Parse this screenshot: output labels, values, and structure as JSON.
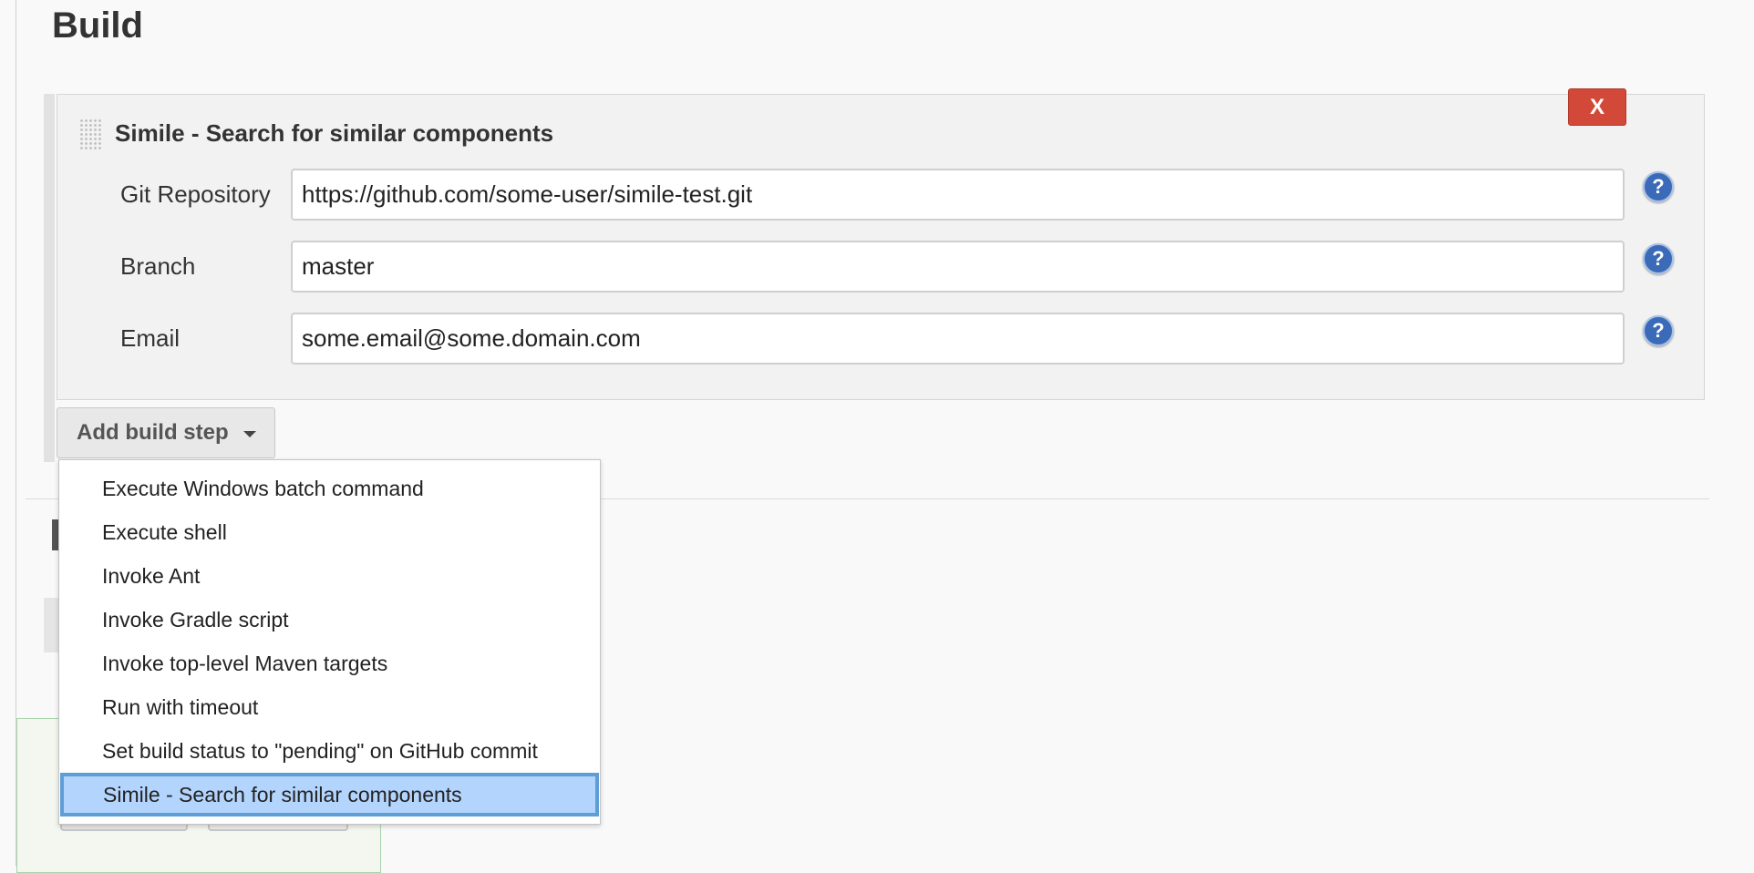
{
  "section": {
    "title": "Build"
  },
  "build_step": {
    "title": "Simile - Search for similar components",
    "delete_label": "X",
    "fields": [
      {
        "label": "Git Repository",
        "value": "https://github.com/some-user/simile-test.git"
      },
      {
        "label": "Branch",
        "value": "master"
      },
      {
        "label": "Email",
        "value": "some.email@some.domain.com"
      }
    ],
    "help_label": "?"
  },
  "add_build_step": {
    "label": "Add build step"
  },
  "dropdown": {
    "items": [
      {
        "label": "Execute Windows batch command"
      },
      {
        "label": "Execute shell"
      },
      {
        "label": "Invoke Ant"
      },
      {
        "label": "Invoke Gradle script"
      },
      {
        "label": "Invoke top-level Maven targets"
      },
      {
        "label": "Run with timeout"
      },
      {
        "label": "Set build status to \"pending\" on GitHub commit"
      },
      {
        "label": "Simile - Search for similar components"
      }
    ],
    "selected_index": 7
  },
  "colors": {
    "delete_button": "#d24939",
    "help_icon": "#3a6ab8",
    "selected_item": "#b3d4fc"
  }
}
